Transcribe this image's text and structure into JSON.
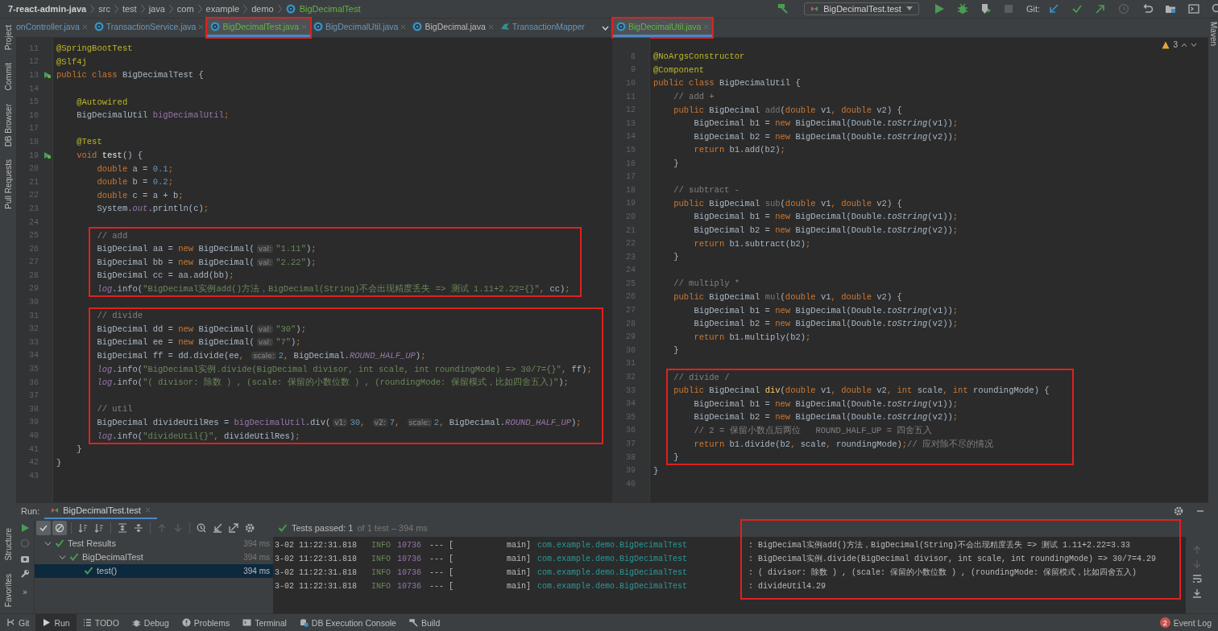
{
  "breadcrumb": [
    "7-react-admin-java",
    "src",
    "test",
    "java",
    "com",
    "example",
    "demo",
    "BigDecimalTest"
  ],
  "toolbar": {
    "run_config": "BigDecimalTest.test",
    "git_label": "Git:"
  },
  "left_stripe": {
    "top": [
      "Project",
      "Commit",
      "DB Browser",
      "Pull Requests"
    ],
    "bottom": [
      "Structure",
      "Favorites"
    ]
  },
  "right_stripe": [
    "Maven"
  ],
  "editors": [
    {
      "tabs": [
        {
          "label": "onController.java",
          "kind": "file",
          "color": "#6897bb",
          "selected": false,
          "marked": false
        },
        {
          "label": "TransactionService.java",
          "kind": "class",
          "color": "#6897bb",
          "selected": false,
          "marked": false
        },
        {
          "label": "BigDecimalTest.java",
          "kind": "class",
          "color": "#62b543",
          "selected": true,
          "marked": true
        },
        {
          "label": "BigDecimalUtil.java",
          "kind": "class",
          "color": "#6897bb",
          "selected": false,
          "marked": false
        },
        {
          "label": "BigDecimal.java",
          "kind": "class",
          "color": "#bbbbbb",
          "selected": false,
          "marked": false
        },
        {
          "label": "TransactionMapper",
          "kind": "mapper",
          "color": "#6897bb",
          "selected": false,
          "marked": false
        }
      ],
      "blocks": [
        {
          "boxed": false,
          "lines": [
            {
              "no": "11",
              "run": false,
              "tokens": [
                {
                  "kind": "ann",
                  "text": "@SpringBootTest"
                }
              ]
            },
            {
              "no": "12",
              "run": false,
              "tokens": [
                {
                  "kind": "ann",
                  "text": "@Slf4j"
                }
              ]
            },
            {
              "no": "13",
              "run": true,
              "tokens": [
                {
                  "kind": "kw",
                  "text": "public class "
                },
                {
                  "kind": "plain",
                  "text": "BigDecimalTest {"
                }
              ]
            },
            {
              "no": "14",
              "run": false
            },
            {
              "no": "15",
              "run": false,
              "tokens": [
                {
                  "kind": "ann",
                  "text": "    @Autowired"
                }
              ]
            },
            {
              "no": "16",
              "run": false,
              "tokens": [
                {
                  "kind": "plain",
                  "text": "    BigDecimalUtil "
                },
                {
                  "kind": "field",
                  "text": "bigDecimalUtil"
                },
                {
                  "kind": "kw",
                  "text": ";"
                }
              ]
            },
            {
              "no": "17",
              "run": false
            },
            {
              "no": "18",
              "run": false,
              "tokens": [
                {
                  "kind": "ann",
                  "text": "    @Test"
                }
              ]
            },
            {
              "no": "19",
              "run": true,
              "tokens": [
                {
                  "kind": "kw",
                  "text": "    void "
                },
                {
                  "kind": "bold",
                  "text": "test"
                },
                {
                  "kind": "plain",
                  "text": "() {"
                }
              ]
            },
            {
              "no": "20",
              "run": false,
              "tokens": [
                {
                  "kind": "kw",
                  "text": "        double "
                },
                {
                  "kind": "plain",
                  "text": "a = "
                },
                {
                  "kind": "num",
                  "text": "0.1"
                },
                {
                  "kind": "kw",
                  "text": ";"
                }
              ]
            },
            {
              "no": "21",
              "run": false,
              "tokens": [
                {
                  "kind": "kw",
                  "text": "        double "
                },
                {
                  "kind": "plain",
                  "text": "b = "
                },
                {
                  "kind": "num",
                  "text": "0.2"
                },
                {
                  "kind": "kw",
                  "text": ";"
                }
              ]
            },
            {
              "no": "22",
              "run": false,
              "tokens": [
                {
                  "kind": "kw",
                  "text": "        double "
                },
                {
                  "kind": "plain",
                  "text": "c = a + b"
                },
                {
                  "kind": "kw",
                  "text": ";"
                }
              ]
            },
            {
              "no": "23",
              "run": false,
              "tokens": [
                {
                  "kind": "plain",
                  "text": "        System."
                },
                {
                  "kind": "static",
                  "text": "out"
                },
                {
                  "kind": "plain",
                  "text": ".println(c)"
                },
                {
                  "kind": "kw",
                  "text": ";"
                }
              ]
            },
            {
              "no": "24",
              "run": false
            }
          ]
        },
        {
          "boxed": true,
          "lines": [
            {
              "no": "25",
              "run": false,
              "tokens": [
                {
                  "kind": "cmt",
                  "text": "        // add"
                }
              ]
            },
            {
              "no": "26",
              "run": false,
              "tokens": [
                {
                  "kind": "plain",
                  "text": "        BigDecimal aa = "
                },
                {
                  "kind": "kw",
                  "text": "new "
                },
                {
                  "kind": "plain",
                  "text": "BigDecimal("
                },
                {
                  "kind": "hint",
                  "text": "val:"
                },
                {
                  "kind": "str",
                  "text": "\"1.11\""
                },
                {
                  "kind": "plain",
                  "text": ")"
                },
                {
                  "kind": "kw",
                  "text": ";"
                }
              ]
            },
            {
              "no": "27",
              "run": false,
              "tokens": [
                {
                  "kind": "plain",
                  "text": "        BigDecimal bb = "
                },
                {
                  "kind": "kw",
                  "text": "new "
                },
                {
                  "kind": "plain",
                  "text": "BigDecimal("
                },
                {
                  "kind": "hint",
                  "text": "val:"
                },
                {
                  "kind": "str",
                  "text": "\"2.22\""
                },
                {
                  "kind": "plain",
                  "text": ")"
                },
                {
                  "kind": "kw",
                  "text": ";"
                }
              ]
            },
            {
              "no": "28",
              "run": false,
              "tokens": [
                {
                  "kind": "plain",
                  "text": "        BigDecimal cc = aa.add(bb)"
                },
                {
                  "kind": "kw",
                  "text": ";"
                }
              ]
            },
            {
              "no": "29",
              "run": false,
              "tokens": [
                {
                  "kind": "static",
                  "text": "        log"
                },
                {
                  "kind": "plain",
                  "text": ".info("
                },
                {
                  "kind": "str",
                  "text": "\"BigDecimal实例add()方法，BigDecimal(String)不会出现精度丢失 => 测试 1.11+2.22={}\""
                },
                {
                  "kind": "kw",
                  "text": ", "
                },
                {
                  "kind": "plain",
                  "text": "cc)"
                },
                {
                  "kind": "kw",
                  "text": ";"
                }
              ]
            }
          ]
        },
        {
          "boxed": false,
          "lines": [
            {
              "no": "30",
              "run": false
            }
          ]
        },
        {
          "boxed": true,
          "lines": [
            {
              "no": "31",
              "run": false,
              "tokens": [
                {
                  "kind": "cmt",
                  "text": "        // divide"
                }
              ]
            },
            {
              "no": "32",
              "run": false,
              "tokens": [
                {
                  "kind": "plain",
                  "text": "        BigDecimal dd = "
                },
                {
                  "kind": "kw",
                  "text": "new "
                },
                {
                  "kind": "plain",
                  "text": "BigDecimal("
                },
                {
                  "kind": "hint",
                  "text": "val:"
                },
                {
                  "kind": "str",
                  "text": "\"30\""
                },
                {
                  "kind": "plain",
                  "text": ")"
                },
                {
                  "kind": "kw",
                  "text": ";"
                }
              ]
            },
            {
              "no": "33",
              "run": false,
              "tokens": [
                {
                  "kind": "plain",
                  "text": "        BigDecimal ee = "
                },
                {
                  "kind": "kw",
                  "text": "new "
                },
                {
                  "kind": "plain",
                  "text": "BigDecimal("
                },
                {
                  "kind": "hint",
                  "text": "val:"
                },
                {
                  "kind": "str",
                  "text": "\"7\""
                },
                {
                  "kind": "plain",
                  "text": ")"
                },
                {
                  "kind": "kw",
                  "text": ";"
                }
              ]
            },
            {
              "no": "34",
              "run": false,
              "tokens": [
                {
                  "kind": "plain",
                  "text": "        BigDecimal ff = dd.divide(ee"
                },
                {
                  "kind": "kw",
                  "text": ", "
                },
                {
                  "kind": "hint",
                  "text": "scale:"
                },
                {
                  "kind": "num",
                  "text": "2"
                },
                {
                  "kind": "kw",
                  "text": ", "
                },
                {
                  "kind": "plain",
                  "text": "BigDecimal."
                },
                {
                  "kind": "static",
                  "text": "ROUND_HALF_UP"
                },
                {
                  "kind": "plain",
                  "text": ")"
                },
                {
                  "kind": "kw",
                  "text": ";"
                }
              ]
            },
            {
              "no": "35",
              "run": false,
              "tokens": [
                {
                  "kind": "static",
                  "text": "        log"
                },
                {
                  "kind": "plain",
                  "text": ".info("
                },
                {
                  "kind": "str",
                  "text": "\"BigDecimal实例.divide(BigDecimal divisor, int scale, int roundingMode) => 30/7={}\""
                },
                {
                  "kind": "kw",
                  "text": ", "
                },
                {
                  "kind": "plain",
                  "text": "ff)"
                },
                {
                  "kind": "kw",
                  "text": ";"
                }
              ]
            },
            {
              "no": "36",
              "run": false,
              "tokens": [
                {
                  "kind": "static",
                  "text": "        log"
                },
                {
                  "kind": "plain",
                  "text": ".info("
                },
                {
                  "kind": "str",
                  "text": "\"( divisor: 除数 ) , (scale: 保留的小数位数 ) , (roundingMode: 保留模式，比如四舍五入)\""
                },
                {
                  "kind": "plain",
                  "text": ")"
                },
                {
                  "kind": "kw",
                  "text": ";"
                }
              ]
            },
            {
              "no": "37",
              "run": false
            },
            {
              "no": "38",
              "run": false,
              "tokens": [
                {
                  "kind": "cmt",
                  "text": "        // util"
                }
              ]
            },
            {
              "no": "39",
              "run": false,
              "tokens": [
                {
                  "kind": "plain",
                  "text": "        BigDecimal divideUtilRes = "
                },
                {
                  "kind": "field",
                  "text": "bigDecimalUtil"
                },
                {
                  "kind": "plain",
                  "text": ".div("
                },
                {
                  "kind": "hint",
                  "text": "v1:"
                },
                {
                  "kind": "num",
                  "text": "30"
                },
                {
                  "kind": "kw",
                  "text": ", "
                },
                {
                  "kind": "hint",
                  "text": "v2:"
                },
                {
                  "kind": "num",
                  "text": "7"
                },
                {
                  "kind": "kw",
                  "text": ", "
                },
                {
                  "kind": "hint",
                  "text": "scale:"
                },
                {
                  "kind": "num",
                  "text": "2"
                },
                {
                  "kind": "kw",
                  "text": ", "
                },
                {
                  "kind": "plain",
                  "text": "BigDecimal."
                },
                {
                  "kind": "static",
                  "text": "ROUND_HALF_UP"
                },
                {
                  "kind": "plain",
                  "text": ")"
                },
                {
                  "kind": "kw",
                  "text": ";"
                }
              ]
            },
            {
              "no": "40",
              "run": false,
              "tokens": [
                {
                  "kind": "static",
                  "text": "        log"
                },
                {
                  "kind": "plain",
                  "text": ".info("
                },
                {
                  "kind": "str",
                  "text": "\"divideUtil{}\""
                },
                {
                  "kind": "kw",
                  "text": ", "
                },
                {
                  "kind": "plain",
                  "text": "divideUtilRes)"
                },
                {
                  "kind": "kw",
                  "text": ";"
                }
              ]
            }
          ]
        },
        {
          "boxed": false,
          "lines": [
            {
              "no": "41",
              "run": false,
              "tokens": [
                {
                  "kind": "plain",
                  "text": "    }"
                }
              ]
            },
            {
              "no": "42",
              "run": false,
              "tokens": [
                {
                  "kind": "plain",
                  "text": "}"
                }
              ]
            },
            {
              "no": "43",
              "run": false
            }
          ]
        }
      ]
    },
    {
      "tabs": [
        {
          "label": "BigDecimalUtil.java",
          "kind": "class",
          "color": "#62b543",
          "selected": true,
          "marked": true
        }
      ],
      "warnings": "3",
      "blocks": [
        {
          "boxed": false,
          "lines": [
            {
              "no": "8",
              "run": false,
              "tokens": [
                {
                  "kind": "ann",
                  "text": "@NoArgsConstructor"
                }
              ]
            },
            {
              "no": "9",
              "run": false,
              "tokens": [
                {
                  "kind": "ann",
                  "text": "@Component"
                }
              ]
            },
            {
              "no": "10",
              "run": false,
              "tokens": [
                {
                  "kind": "kw",
                  "text": "public class "
                },
                {
                  "kind": "plain",
                  "text": "BigDecimalUtil {"
                }
              ]
            },
            {
              "no": "11",
              "run": false,
              "tokens": [
                {
                  "kind": "cmt",
                  "text": "    // add +"
                }
              ]
            },
            {
              "no": "12",
              "run": false,
              "tokens": [
                {
                  "kind": "kw",
                  "text": "    public "
                },
                {
                  "kind": "plain",
                  "text": "BigDecimal "
                },
                {
                  "kind": "unused",
                  "text": "add"
                },
                {
                  "kind": "plain",
                  "text": "("
                },
                {
                  "kind": "kw",
                  "text": "double "
                },
                {
                  "kind": "plain",
                  "text": "v1"
                },
                {
                  "kind": "kw",
                  "text": ", double "
                },
                {
                  "kind": "plain",
                  "text": "v2) {"
                }
              ]
            },
            {
              "no": "13",
              "run": false,
              "tokens": [
                {
                  "kind": "plain",
                  "text": "        BigDecimal b1 = "
                },
                {
                  "kind": "kw",
                  "text": "new "
                },
                {
                  "kind": "plain",
                  "text": "BigDecimal(Double."
                },
                {
                  "kind": "method",
                  "text": "toString"
                },
                {
                  "kind": "plain",
                  "text": "(v1))"
                },
                {
                  "kind": "kw",
                  "text": ";"
                }
              ]
            },
            {
              "no": "14",
              "run": false,
              "tokens": [
                {
                  "kind": "plain",
                  "text": "        BigDecimal b2 = "
                },
                {
                  "kind": "kw",
                  "text": "new "
                },
                {
                  "kind": "plain",
                  "text": "BigDecimal(Double."
                },
                {
                  "kind": "method",
                  "text": "toString"
                },
                {
                  "kind": "plain",
                  "text": "(v2))"
                },
                {
                  "kind": "kw",
                  "text": ";"
                }
              ]
            },
            {
              "no": "15",
              "run": false,
              "tokens": [
                {
                  "kind": "kw",
                  "text": "        return "
                },
                {
                  "kind": "plain",
                  "text": "b1.add(b2)"
                },
                {
                  "kind": "kw",
                  "text": ";"
                }
              ]
            },
            {
              "no": "16",
              "run": false,
              "tokens": [
                {
                  "kind": "plain",
                  "text": "    }"
                }
              ]
            },
            {
              "no": "17",
              "run": false
            },
            {
              "no": "18",
              "run": false,
              "tokens": [
                {
                  "kind": "cmt",
                  "text": "    // subtract -"
                }
              ]
            },
            {
              "no": "19",
              "run": false,
              "tokens": [
                {
                  "kind": "kw",
                  "text": "    public "
                },
                {
                  "kind": "plain",
                  "text": "BigDecimal "
                },
                {
                  "kind": "unused",
                  "text": "sub"
                },
                {
                  "kind": "plain",
                  "text": "("
                },
                {
                  "kind": "kw",
                  "text": "double "
                },
                {
                  "kind": "plain",
                  "text": "v1"
                },
                {
                  "kind": "kw",
                  "text": ", double "
                },
                {
                  "kind": "plain",
                  "text": "v2) {"
                }
              ]
            },
            {
              "no": "20",
              "run": false,
              "tokens": [
                {
                  "kind": "plain",
                  "text": "        BigDecimal b1 = "
                },
                {
                  "kind": "kw",
                  "text": "new "
                },
                {
                  "kind": "plain",
                  "text": "BigDecimal(Double."
                },
                {
                  "kind": "method",
                  "text": "toString"
                },
                {
                  "kind": "plain",
                  "text": "(v1))"
                },
                {
                  "kind": "kw",
                  "text": ";"
                }
              ]
            },
            {
              "no": "21",
              "run": false,
              "tokens": [
                {
                  "kind": "plain",
                  "text": "        BigDecimal b2 = "
                },
                {
                  "kind": "kw",
                  "text": "new "
                },
                {
                  "kind": "plain",
                  "text": "BigDecimal(Double."
                },
                {
                  "kind": "method",
                  "text": "toString"
                },
                {
                  "kind": "plain",
                  "text": "(v2))"
                },
                {
                  "kind": "kw",
                  "text": ";"
                }
              ]
            },
            {
              "no": "22",
              "run": false,
              "tokens": [
                {
                  "kind": "kw",
                  "text": "        return "
                },
                {
                  "kind": "plain",
                  "text": "b1.subtract(b2)"
                },
                {
                  "kind": "kw",
                  "text": ";"
                }
              ]
            },
            {
              "no": "23",
              "run": false,
              "tokens": [
                {
                  "kind": "plain",
                  "text": "    }"
                }
              ]
            },
            {
              "no": "24",
              "run": false
            },
            {
              "no": "25",
              "run": false,
              "tokens": [
                {
                  "kind": "cmt",
                  "text": "    // multiply *"
                }
              ]
            },
            {
              "no": "26",
              "run": false,
              "tokens": [
                {
                  "kind": "kw",
                  "text": "    public "
                },
                {
                  "kind": "plain",
                  "text": "BigDecimal "
                },
                {
                  "kind": "unused",
                  "text": "mul"
                },
                {
                  "kind": "plain",
                  "text": "("
                },
                {
                  "kind": "kw",
                  "text": "double "
                },
                {
                  "kind": "plain",
                  "text": "v1"
                },
                {
                  "kind": "kw",
                  "text": ", double "
                },
                {
                  "kind": "plain",
                  "text": "v2) {"
                }
              ]
            },
            {
              "no": "27",
              "run": false,
              "tokens": [
                {
                  "kind": "plain",
                  "text": "        BigDecimal b1 = "
                },
                {
                  "kind": "kw",
                  "text": "new "
                },
                {
                  "kind": "plain",
                  "text": "BigDecimal(Double."
                },
                {
                  "kind": "method",
                  "text": "toString"
                },
                {
                  "kind": "plain",
                  "text": "(v1))"
                },
                {
                  "kind": "kw",
                  "text": ";"
                }
              ]
            },
            {
              "no": "28",
              "run": false,
              "tokens": [
                {
                  "kind": "plain",
                  "text": "        BigDecimal b2 = "
                },
                {
                  "kind": "kw",
                  "text": "new "
                },
                {
                  "kind": "plain",
                  "text": "BigDecimal(Double."
                },
                {
                  "kind": "method",
                  "text": "toString"
                },
                {
                  "kind": "plain",
                  "text": "(v2))"
                },
                {
                  "kind": "kw",
                  "text": ";"
                }
              ]
            },
            {
              "no": "29",
              "run": false,
              "tokens": [
                {
                  "kind": "kw",
                  "text": "        return "
                },
                {
                  "kind": "plain",
                  "text": "b1.multiply(b2)"
                },
                {
                  "kind": "kw",
                  "text": ";"
                }
              ]
            },
            {
              "no": "30",
              "run": false,
              "tokens": [
                {
                  "kind": "plain",
                  "text": "    }"
                }
              ]
            },
            {
              "no": "31",
              "run": false
            }
          ]
        },
        {
          "boxed": true,
          "lines": [
            {
              "no": "32",
              "run": false,
              "tokens": [
                {
                  "kind": "cmt",
                  "text": "    // divide /"
                }
              ]
            },
            {
              "no": "33",
              "run": false,
              "tokens": [
                {
                  "kind": "kw",
                  "text": "    public "
                },
                {
                  "kind": "plain",
                  "text": "BigDecimal "
                },
                {
                  "kind": "decl",
                  "text": "div"
                },
                {
                  "kind": "plain",
                  "text": "("
                },
                {
                  "kind": "kw",
                  "text": "double "
                },
                {
                  "kind": "plain",
                  "text": "v1"
                },
                {
                  "kind": "kw",
                  "text": ", double "
                },
                {
                  "kind": "plain",
                  "text": "v2"
                },
                {
                  "kind": "kw",
                  "text": ", int "
                },
                {
                  "kind": "plain",
                  "text": "scale"
                },
                {
                  "kind": "kw",
                  "text": ", int "
                },
                {
                  "kind": "plain",
                  "text": "roundingMode) {"
                }
              ]
            },
            {
              "no": "34",
              "run": false,
              "tokens": [
                {
                  "kind": "plain",
                  "text": "        BigDecimal b1 = "
                },
                {
                  "kind": "kw",
                  "text": "new "
                },
                {
                  "kind": "plain",
                  "text": "BigDecimal(Double."
                },
                {
                  "kind": "method",
                  "text": "toString"
                },
                {
                  "kind": "plain",
                  "text": "(v1))"
                },
                {
                  "kind": "kw",
                  "text": ";"
                }
              ]
            },
            {
              "no": "35",
              "run": false,
              "tokens": [
                {
                  "kind": "plain",
                  "text": "        BigDecimal b2 = "
                },
                {
                  "kind": "kw",
                  "text": "new "
                },
                {
                  "kind": "plain",
                  "text": "BigDecimal(Double."
                },
                {
                  "kind": "method",
                  "text": "toString"
                },
                {
                  "kind": "plain",
                  "text": "(v2))"
                },
                {
                  "kind": "kw",
                  "text": ";"
                }
              ]
            },
            {
              "no": "36",
              "run": false,
              "tokens": [
                {
                  "kind": "cmt",
                  "text": "        // 2 = 保留小数点后两位   ROUND_HALF_UP = 四舍五入"
                }
              ]
            },
            {
              "no": "37",
              "run": false,
              "tokens": [
                {
                  "kind": "kw",
                  "text": "        return "
                },
                {
                  "kind": "plain",
                  "text": "b1.divide(b2"
                },
                {
                  "kind": "kw",
                  "text": ", "
                },
                {
                  "kind": "plain",
                  "text": "scale"
                },
                {
                  "kind": "kw",
                  "text": ", "
                },
                {
                  "kind": "plain",
                  "text": "roundingMode)"
                },
                {
                  "kind": "kw",
                  "text": ";"
                },
                {
                  "kind": "cmt",
                  "text": "// 应对除不尽的情况"
                }
              ]
            },
            {
              "no": "38",
              "run": false,
              "tokens": [
                {
                  "kind": "plain",
                  "text": "    }"
                }
              ]
            }
          ]
        },
        {
          "boxed": false,
          "lines": [
            {
              "no": "39",
              "run": false,
              "tokens": [
                {
                  "kind": "plain",
                  "text": "}"
                }
              ]
            },
            {
              "no": "40",
              "run": false
            }
          ]
        }
      ]
    }
  ],
  "run_panel": {
    "title": "Run:",
    "tab": "BigDecimalTest.test",
    "more": "»",
    "tools": [
      {
        "kind": "check",
        "on": true
      },
      {
        "kind": "ban",
        "on": true
      },
      {
        "kind": "sort",
        "on": false
      },
      {
        "kind": "sort",
        "on": false
      },
      {
        "kind": "expand",
        "on": false
      },
      {
        "kind": "collapse",
        "on": false
      },
      {
        "kind": "up",
        "on": false
      },
      {
        "kind": "down",
        "on": false
      },
      {
        "kind": "clock",
        "on": false
      },
      {
        "kind": "import",
        "on": false
      },
      {
        "kind": "export",
        "on": false
      },
      {
        "kind": "gear",
        "on": false
      }
    ],
    "status": "Tests passed: 1",
    "status_detail": "of 1 test – 394 ms",
    "tests": [
      {
        "label": "Test Results",
        "time": "394 ms",
        "passed": true,
        "selected": false,
        "children": [
          {
            "label": "BigDecimalTest",
            "time": "394 ms",
            "passed": true,
            "selected": false,
            "children": [
              {
                "label": "test()",
                "time": "394 ms",
                "passed": true,
                "selected": true
              }
            ]
          }
        ]
      }
    ],
    "console": {
      "boxed": true,
      "rows": [
        {
          "time": "3-02 11:22:31.818",
          "level": "INFO",
          "pid": "10736",
          "sep": "---",
          "bracket": "[",
          "thread": "main]",
          "logger": "com.example.demo.BigDecimalTest",
          "message": ": BigDecimal实例add()方法，BigDecimal(String)不会出现精度丢失 => 测试 1.11+2.22=3.33"
        },
        {
          "time": "3-02 11:22:31.818",
          "level": "INFO",
          "pid": "10736",
          "sep": "---",
          "bracket": "[",
          "thread": "main]",
          "logger": "com.example.demo.BigDecimalTest",
          "message": ": BigDecimal实例.divide(BigDecimal divisor, int scale, int roundingMode) => 30/7=4.29"
        },
        {
          "time": "3-02 11:22:31.818",
          "level": "INFO",
          "pid": "10736",
          "sep": "---",
          "bracket": "[",
          "thread": "main]",
          "logger": "com.example.demo.BigDecimalTest",
          "message": ": ( divisor: 除数 ) , (scale: 保留的小数位数 ) , (roundingMode: 保留模式，比如四舍五入)"
        },
        {
          "time": "3-02 11:22:31.818",
          "level": "INFO",
          "pid": "10736",
          "sep": "---",
          "bracket": "[",
          "thread": "main]",
          "logger": "com.example.demo.BigDecimalTest",
          "message": ": divideUtil4.29"
        }
      ]
    }
  },
  "bottom_tabs": [
    {
      "label": "Git",
      "selected": false
    },
    {
      "label": "Run",
      "selected": true
    },
    {
      "label": "TODO",
      "selected": false
    },
    {
      "label": "Debug",
      "selected": false
    },
    {
      "label": "Problems",
      "selected": false
    },
    {
      "label": "Terminal",
      "selected": false
    },
    {
      "label": "DB Execution Console",
      "selected": false
    },
    {
      "label": "Build",
      "selected": false
    }
  ],
  "event_log": {
    "label": "Event Log",
    "count": "2"
  }
}
